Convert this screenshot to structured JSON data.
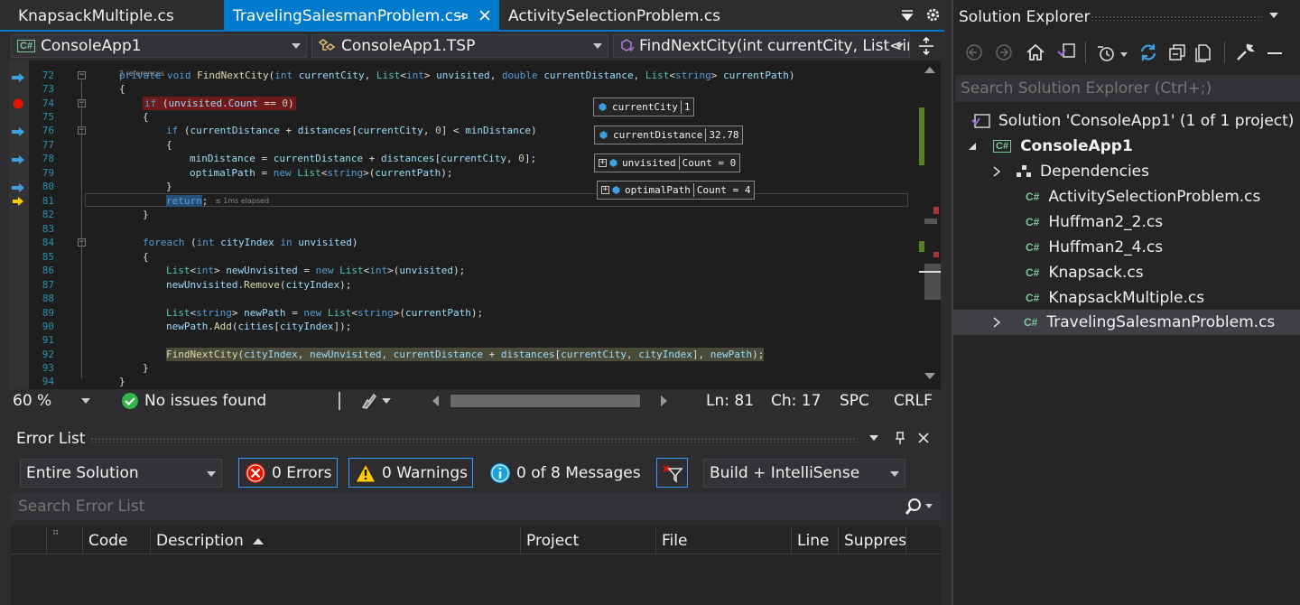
{
  "tabs": [
    {
      "label": "KnapsackMultiple.cs"
    },
    {
      "label": "TravelingSalesmanProblem.cs"
    },
    {
      "label": "ActivitySelectionProblem.cs"
    }
  ],
  "nav": {
    "project": "ConsoleApp1",
    "class": "ConsoleApp1.TSP",
    "member": "FindNextCity(int currentCity, List<in"
  },
  "editor": {
    "references": "2 references",
    "line_numbers": [
      "72",
      "73",
      "74",
      "75",
      "76",
      "77",
      "78",
      "79",
      "80",
      "81",
      "82",
      "83",
      "84",
      "85",
      "86",
      "87",
      "88",
      "89",
      "90",
      "91",
      "92",
      "93",
      "94"
    ],
    "elapsed": "≤ 1ms elapsed",
    "datatips": [
      {
        "name": "currentCity",
        "value": "1"
      },
      {
        "name": "currentDistance",
        "value": "32.78"
      },
      {
        "name": "unvisited",
        "value": "Count = 0"
      },
      {
        "name": "optimalPath",
        "value": "Count = 4"
      }
    ]
  },
  "status": {
    "zoom": "60 %",
    "issues": "No issues found",
    "ln": "Ln: 81",
    "ch": "Ch: 17",
    "encoding": "SPC",
    "eol": "CRLF"
  },
  "errorlist": {
    "title": "Error List",
    "scope": "Entire Solution",
    "errors": "0 Errors",
    "warnings": "0 Warnings",
    "messages": "0 of 8 Messages",
    "build": "Build + IntelliSense",
    "search_placeholder": "Search Error List",
    "columns": [
      "Code",
      "Description",
      "Project",
      "File",
      "Line",
      "Suppres"
    ]
  },
  "solution": {
    "title": "Solution Explorer",
    "search_placeholder": "Search Solution Explorer (Ctrl+;)",
    "solution_label": "Solution 'ConsoleApp1' (1 of 1 project)",
    "project": "ConsoleApp1",
    "dependencies": "Dependencies",
    "files": [
      "ActivitySelectionProblem.cs",
      "Huffman2_2.cs",
      "Huffman2_4.cs",
      "Knapsack.cs",
      "KnapsackMultiple.cs",
      "TravelingSalesmanProblem.cs"
    ],
    "cs_badge": "C#"
  },
  "colors": {
    "accent": "#007acc",
    "breakpoint": "#e51400",
    "error": "#e51400",
    "warning": "#ffcc00",
    "info": "#1ba1e2",
    "ok": "#36b24a"
  }
}
